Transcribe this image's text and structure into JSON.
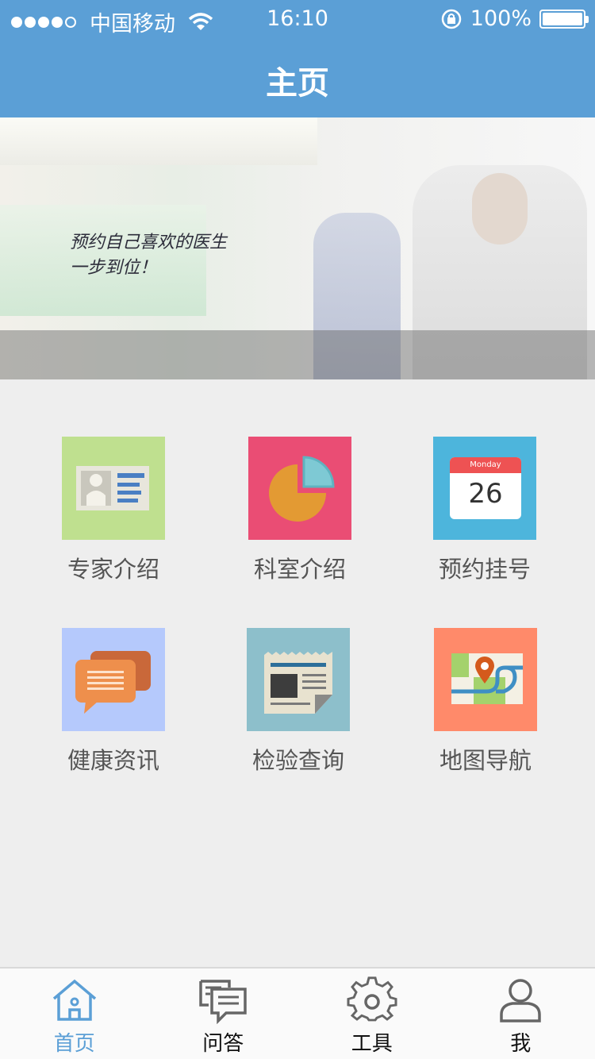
{
  "status_bar": {
    "carrier": "中国移动",
    "time": "16:10",
    "battery": "100%"
  },
  "header": {
    "title": "主页"
  },
  "banner": {
    "slogan_line1": "预约自己喜欢的医生",
    "slogan_line2": "一步到位！"
  },
  "grid": [
    {
      "label": "专家介绍",
      "icon": "id-card-icon",
      "bg": "#bfe08f"
    },
    {
      "label": "科室介绍",
      "icon": "pie-chart-icon",
      "bg": "#ea4d74"
    },
    {
      "label": "预约挂号",
      "icon": "calendar-icon",
      "bg": "#4db5dc",
      "calendar_day": "Monday",
      "calendar_date": "26"
    },
    {
      "label": "健康资讯",
      "icon": "chat-bubbles-icon",
      "bg": "#b5c9fc"
    },
    {
      "label": "检验查询",
      "icon": "newspaper-icon",
      "bg": "#8dbfcb"
    },
    {
      "label": "地图导航",
      "icon": "map-pin-icon",
      "bg": "#ff8a6a"
    }
  ],
  "tabbar": [
    {
      "label": "首页",
      "icon": "home-icon",
      "active": true
    },
    {
      "label": "问答",
      "icon": "qa-icon",
      "active": false
    },
    {
      "label": "工具",
      "icon": "gear-icon",
      "active": false
    },
    {
      "label": "我",
      "icon": "user-icon",
      "active": false
    }
  ],
  "colors": {
    "primary": "#5b9fd6",
    "background": "#eeeeee"
  }
}
